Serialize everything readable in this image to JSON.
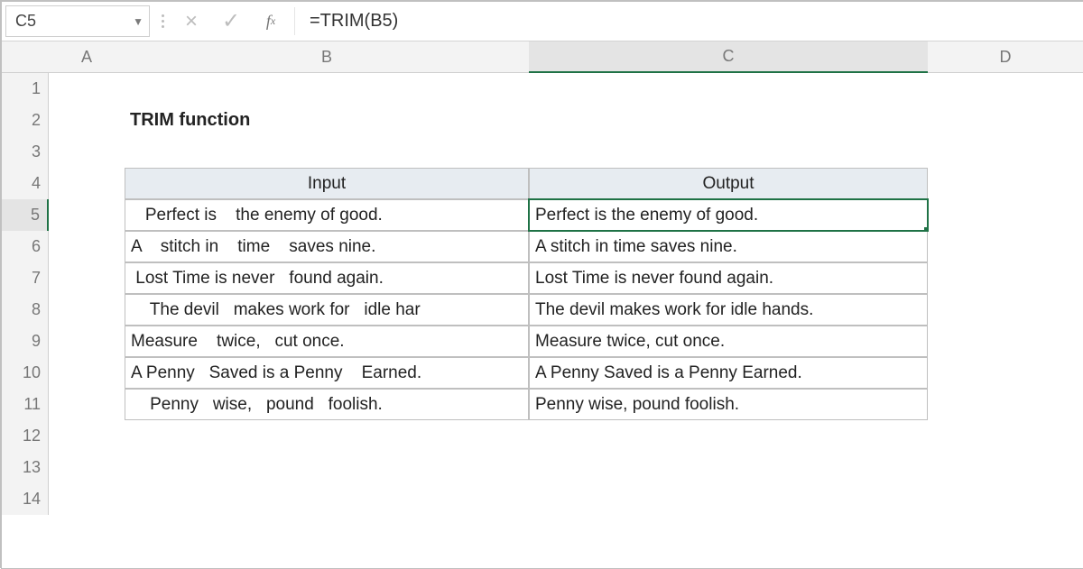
{
  "formula_bar": {
    "name_box": "C5",
    "formula": "=TRIM(B5)"
  },
  "columns": {
    "A": "A",
    "B": "B",
    "C": "C",
    "D": "D"
  },
  "rows": [
    "1",
    "2",
    "3",
    "4",
    "5",
    "6",
    "7",
    "8",
    "9",
    "10",
    "11",
    "12",
    "13",
    "14"
  ],
  "title": "TRIM function",
  "table": {
    "headers": {
      "input": "Input",
      "output": "Output"
    },
    "rows": [
      {
        "input": "   Perfect is    the enemy of good.",
        "output": "Perfect is the enemy of good."
      },
      {
        "input": "A    stitch in    time    saves nine.",
        "output": "A stitch in time saves nine."
      },
      {
        "input": " Lost Time is never   found again.",
        "output": "Lost Time is never found again."
      },
      {
        "input": "    The devil   makes work for   idle har",
        "output": "The devil makes work for idle hands."
      },
      {
        "input": "Measure    twice,   cut once.",
        "output": "Measure twice, cut once."
      },
      {
        "input": "A Penny   Saved is a Penny    Earned.",
        "output": "A Penny Saved is a Penny Earned."
      },
      {
        "input": "    Penny   wise,   pound   foolish.",
        "output": "Penny wise, pound foolish."
      }
    ]
  },
  "active_cell": "C5"
}
